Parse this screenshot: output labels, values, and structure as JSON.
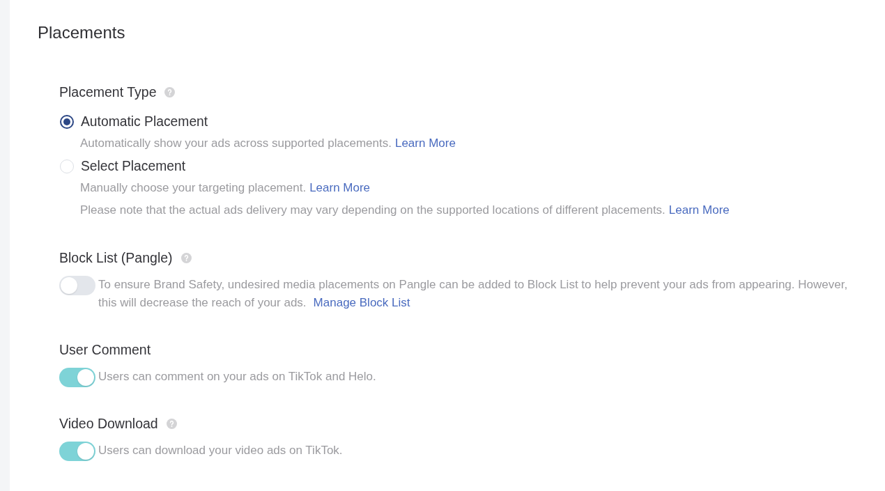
{
  "title": "Placements",
  "sections": [
    {
      "kind": "radio_group",
      "label": "Placement Type",
      "help": true,
      "options": [
        {
          "label": "Automatic Placement",
          "selected": true,
          "descriptions": [
            {
              "text": "Automatically show your ads across supported placements.",
              "link": "Learn More"
            }
          ]
        },
        {
          "label": "Select Placement",
          "selected": false,
          "descriptions": [
            {
              "text": "Manually choose your targeting placement.",
              "link": "Learn More"
            },
            {
              "text": "Please note that the actual ads delivery may vary depending on the supported locations of different placements.",
              "link": "Learn More"
            }
          ]
        }
      ]
    },
    {
      "kind": "toggle",
      "label": "Block List (Pangle)",
      "help": true,
      "on": false,
      "description": {
        "text": "To ensure Brand Safety, undesired media placements on Pangle can be added to Block List to help prevent your ads from appearing. However, this will decrease the reach of your ads.",
        "link": "Manage Block List"
      }
    },
    {
      "kind": "toggle",
      "label": "User Comment",
      "help": false,
      "on": true,
      "description": {
        "text": "Users can comment on your ads on TikTok and Helo."
      }
    },
    {
      "kind": "toggle",
      "label": "Video Download",
      "help": true,
      "on": true,
      "description": {
        "text": "Users can download your video ads on TikTok."
      }
    }
  ]
}
